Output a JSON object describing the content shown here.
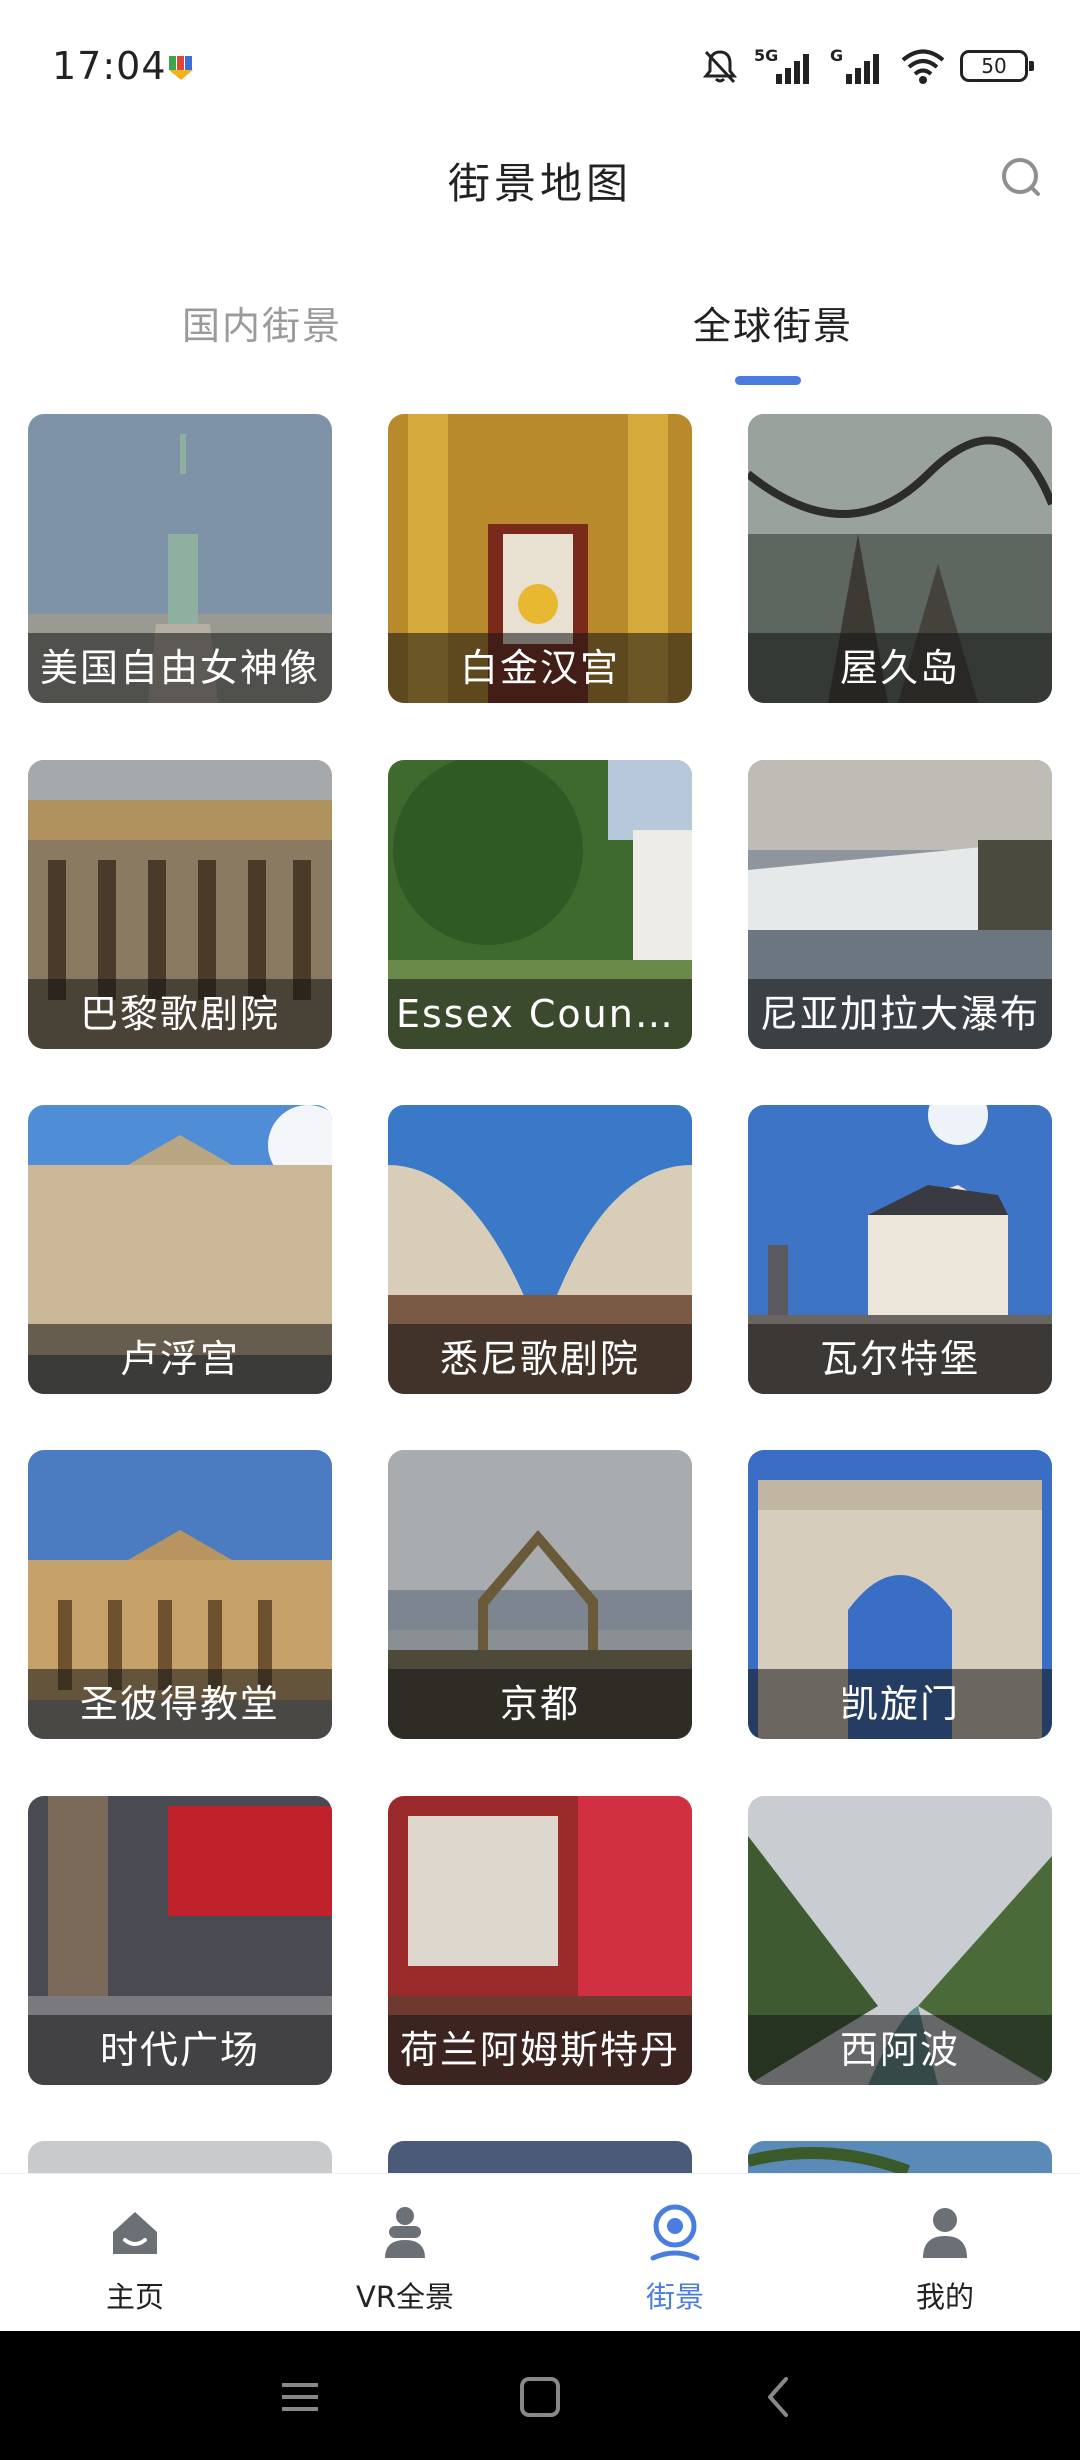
{
  "status_bar": {
    "time": "17:04",
    "network_1": "5G",
    "network_2": "G",
    "battery": "50",
    "icons": [
      "app-notification-icon",
      "mute-icon",
      "signal-icon",
      "wifi-icon",
      "battery-icon"
    ]
  },
  "header": {
    "title": "街景地图",
    "search_icon": "search-icon"
  },
  "tabs": [
    {
      "label": "国内街景",
      "active": false
    },
    {
      "label": "全球街景",
      "active": true
    }
  ],
  "colors": {
    "accent": "#4a7de0",
    "text": "#222222",
    "muted": "#9a9a9a"
  },
  "places": [
    {
      "label": "美国自由女神像"
    },
    {
      "label": "白金汉宫"
    },
    {
      "label": "屋久岛"
    },
    {
      "label": "巴黎歌剧院"
    },
    {
      "label": "Essex Count..."
    },
    {
      "label": "尼亚加拉大瀑布"
    },
    {
      "label": "卢浮宫"
    },
    {
      "label": "悉尼歌剧院"
    },
    {
      "label": "瓦尔特堡"
    },
    {
      "label": "圣彼得教堂"
    },
    {
      "label": "京都"
    },
    {
      "label": "凯旋门"
    },
    {
      "label": "时代广场"
    },
    {
      "label": "荷兰阿姆斯特丹"
    },
    {
      "label": "西阿波"
    },
    {
      "label": ""
    },
    {
      "label": ""
    },
    {
      "label": ""
    }
  ],
  "bottom_nav": [
    {
      "label": "主页",
      "icon": "home-icon",
      "active": false
    },
    {
      "label": "VR全景",
      "icon": "vr-icon",
      "active": false
    },
    {
      "label": "街景",
      "icon": "street-view-icon",
      "active": true
    },
    {
      "label": "我的",
      "icon": "profile-icon",
      "active": false
    }
  ],
  "system_nav": [
    "menu-icon",
    "home-square-icon",
    "back-icon"
  ]
}
